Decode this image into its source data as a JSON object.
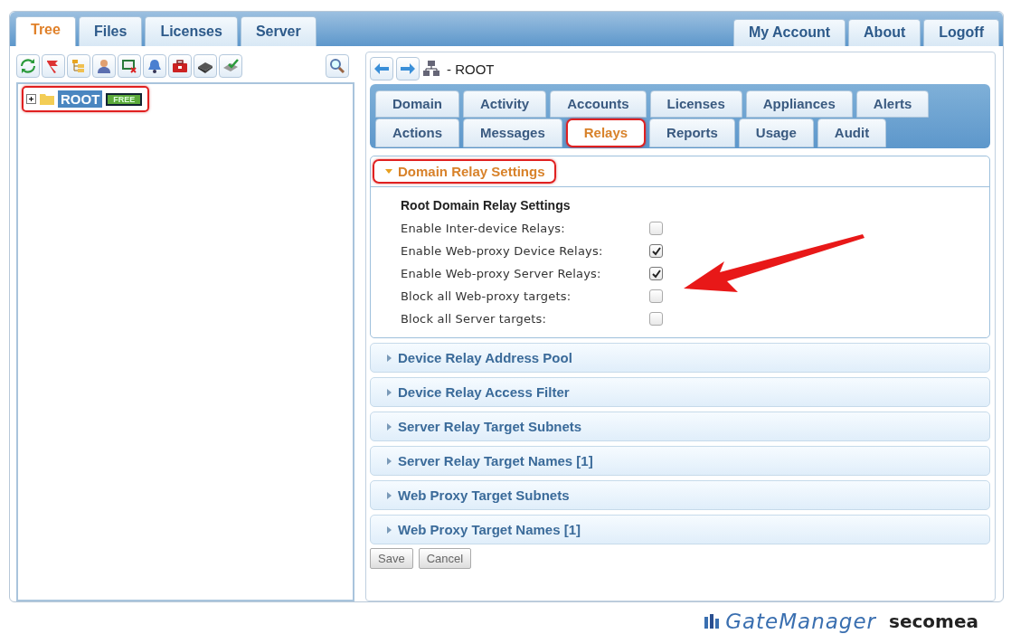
{
  "main_tabs": [
    {
      "label": "Tree",
      "selected": true
    },
    {
      "label": "Files",
      "selected": false
    },
    {
      "label": "Licenses",
      "selected": false
    },
    {
      "label": "Server",
      "selected": false
    }
  ],
  "account_buttons": [
    "My Account",
    "About",
    "Logoff"
  ],
  "tree": [
    {
      "label": "ROOT",
      "badge": "FREE",
      "expanded": false,
      "selected": true,
      "annotated": true
    }
  ],
  "breadcrumb": "- ROOT",
  "detail_tab_rows": [
    {
      "tabs": [
        {
          "label": "Domain",
          "selected": false,
          "annotated": false
        },
        {
          "label": "Activity",
          "selected": false,
          "annotated": false
        },
        {
          "label": "Accounts",
          "selected": false,
          "annotated": false
        },
        {
          "label": "Licenses",
          "selected": false,
          "annotated": false
        },
        {
          "label": "Appliances",
          "selected": false,
          "annotated": false
        },
        {
          "label": "Alerts",
          "selected": false,
          "annotated": false
        }
      ]
    },
    {
      "tabs": [
        {
          "label": "Actions",
          "selected": false,
          "annotated": false
        },
        {
          "label": "Messages",
          "selected": false,
          "annotated": false
        },
        {
          "label": "Relays",
          "selected": true,
          "annotated": true
        },
        {
          "label": "Reports",
          "selected": false,
          "annotated": false
        },
        {
          "label": "Usage",
          "selected": false,
          "annotated": false
        },
        {
          "label": "Audit",
          "selected": false,
          "annotated": false
        }
      ]
    }
  ],
  "sections": [
    {
      "title": "Domain Relay Settings",
      "expanded": true,
      "annotated": true,
      "heading": "Root Domain Relay Settings",
      "options": [
        {
          "label": "Enable Inter-device Relays:",
          "checked": false
        },
        {
          "label": "Enable Web-proxy Device Relays:",
          "checked": true
        },
        {
          "label": "Enable Web-proxy Server Relays:",
          "checked": true
        },
        {
          "label": "Block all Web-proxy targets:",
          "checked": false
        },
        {
          "label": "Block all Server targets:",
          "checked": false
        }
      ]
    },
    {
      "title": "Device Relay Address Pool",
      "expanded": false,
      "annotated": false
    },
    {
      "title": "Device Relay Access Filter",
      "expanded": false,
      "annotated": false
    },
    {
      "title": "Server Relay Target Subnets",
      "expanded": false,
      "annotated": false
    },
    {
      "title": "Server Relay Target Names [1]",
      "expanded": false,
      "annotated": false
    },
    {
      "title": "Web Proxy Target Subnets",
      "expanded": false,
      "annotated": false
    },
    {
      "title": "Web Proxy Target Names [1]",
      "expanded": false,
      "annotated": false
    }
  ],
  "form_buttons": [
    "Save",
    "Cancel"
  ],
  "footer": {
    "product": "GateManager",
    "brand": "secomea"
  }
}
